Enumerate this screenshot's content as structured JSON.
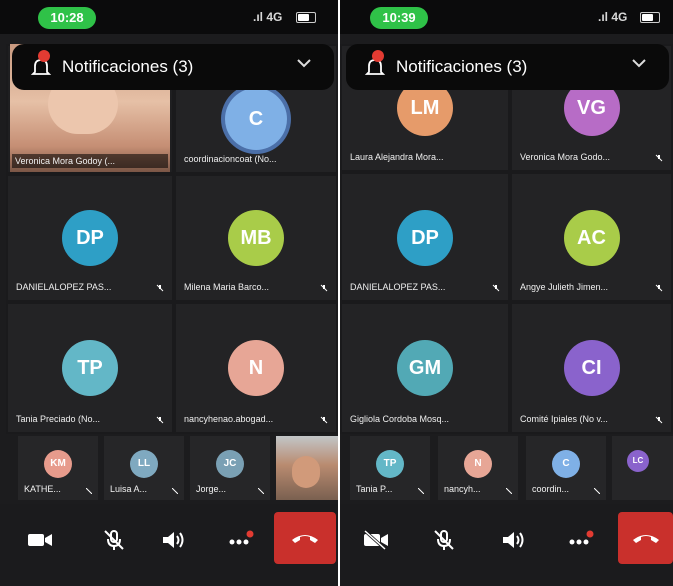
{
  "left": {
    "time": "10:28",
    "signal": "4G",
    "notification": "Notificaciones (3)",
    "participants": [
      {
        "name": "Veronica Mora Godoy (...",
        "initials": "",
        "color": "",
        "video": true
      },
      {
        "name": "coordinacioncoat (No...",
        "initials": "C",
        "color": "#7fb0e6",
        "video": false
      },
      {
        "name": "DANIELALOPEZ PAS...",
        "initials": "DP",
        "color": "#2e9fc6",
        "video": false
      },
      {
        "name": "Milena Maria Barco...",
        "initials": "MB",
        "color": "#a9cc49",
        "video": false
      },
      {
        "name": "Tania Preciado (No...",
        "initials": "TP",
        "color": "#63b7c7",
        "video": false
      },
      {
        "name": "nancyhenao.abogad...",
        "initials": "N",
        "color": "#e7a696",
        "video": false
      }
    ],
    "strip": [
      {
        "name": "KATHE...",
        "initials": "KM",
        "color": "#e79b8c"
      },
      {
        "name": "Luisa A...",
        "initials": "LL",
        "color": "#7fa9c0"
      },
      {
        "name": "Jorge...",
        "initials": "JC",
        "color": "#7aa0b4"
      }
    ]
  },
  "right": {
    "time": "10:39",
    "signal": "4G",
    "notification": "Notificaciones (3)",
    "participants": [
      {
        "name": "Laura Alejandra Mora...",
        "initials": "LM",
        "color": "#e69b6a"
      },
      {
        "name": "Veronica Mora Godo...",
        "initials": "VG",
        "color": "#b76cc6"
      },
      {
        "name": "DANIELALOPEZ PAS...",
        "initials": "DP",
        "color": "#2e9fc6"
      },
      {
        "name": "Angye Julieth Jimen...",
        "initials": "AC",
        "color": "#a9cc49"
      },
      {
        "name": "Gigliola Cordoba Mosq...",
        "initials": "GM",
        "color": "#52a9b5"
      },
      {
        "name": "Comité Ipiales (No v...",
        "initials": "CI",
        "color": "#8a63cc"
      }
    ],
    "strip": [
      {
        "name": "Tania P...",
        "initials": "TP",
        "color": "#63b7c7"
      },
      {
        "name": "nancyh...",
        "initials": "N",
        "color": "#e7a696"
      },
      {
        "name": "coordin...",
        "initials": "C",
        "color": "#7fb0e6"
      },
      {
        "name": "",
        "initials": "LC",
        "color": "#8a63cc"
      }
    ]
  },
  "icons": {
    "camera": "camera-icon",
    "mic": "mic-off-icon",
    "speaker": "speaker-icon",
    "more": "more-icon",
    "hangup": "hang-up-icon"
  }
}
